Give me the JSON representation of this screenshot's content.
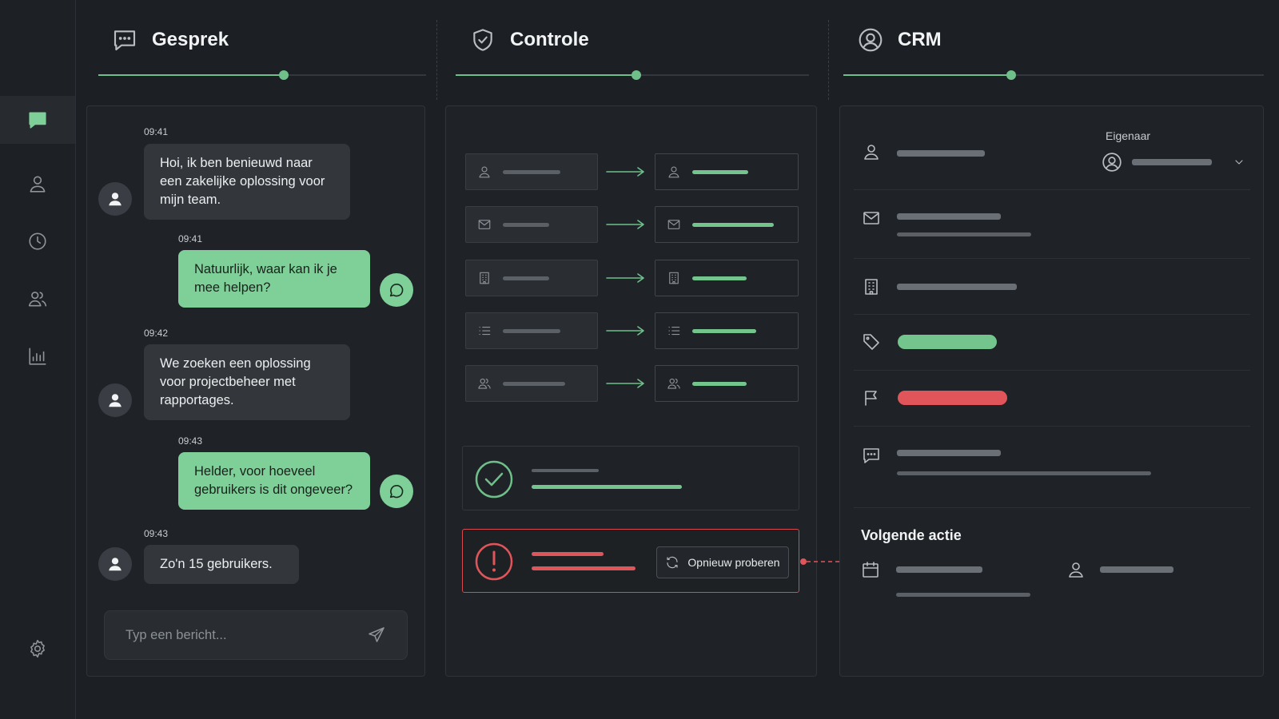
{
  "sidebar": {
    "items": [
      {
        "name": "chat",
        "active": true
      },
      {
        "name": "user"
      },
      {
        "name": "history"
      },
      {
        "name": "team"
      },
      {
        "name": "reports"
      }
    ],
    "settings": "settings"
  },
  "columns": {
    "chat": {
      "title": "Gesprek",
      "progress": 0.46
    },
    "check": {
      "title": "Controle",
      "progress": 0.51
    },
    "crm": {
      "title": "CRM",
      "progress": 0.4
    }
  },
  "chat": {
    "messages": [
      {
        "time": "09:41",
        "from": "customer",
        "text": "Hoi, ik ben benieuwd naar een zakelijke oplossing voor mijn team."
      },
      {
        "time": "09:41",
        "from": "agent",
        "text": "Natuurlijk, waar kan ik je mee helpen?"
      },
      {
        "time": "09:42",
        "from": "customer",
        "text": "We zoeken een oplossing voor projectbeheer met rapportages."
      },
      {
        "time": "09:43",
        "from": "agent",
        "text": "Helder, voor hoeveel gebruikers is dit ongeveer?"
      },
      {
        "time": "09:43",
        "from": "customer",
        "text": "Zo'n 15 gebruikers."
      }
    ],
    "input_placeholder": "Typ een bericht..."
  },
  "check": {
    "mappings": [
      {
        "icon": "user-icon"
      },
      {
        "icon": "mail-icon"
      },
      {
        "icon": "building-icon"
      },
      {
        "icon": "list-icon"
      },
      {
        "icon": "users-icon"
      }
    ],
    "success": {
      "status": "ok"
    },
    "error": {
      "status": "error",
      "retry_label": "Opnieuw proberen"
    }
  },
  "crm": {
    "owner_label": "Eigenaar",
    "next_action_title": "Volgende actie",
    "tag_color": "#74c48e",
    "flag_color": "#e0555a"
  },
  "colors": {
    "accent": "#7fcf98",
    "error": "#d64a50",
    "background": "#1c1f23"
  }
}
